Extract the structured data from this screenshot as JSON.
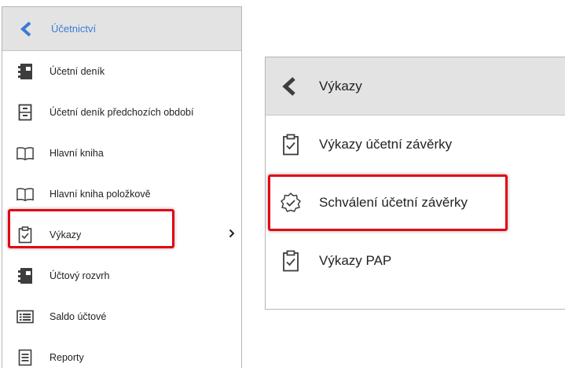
{
  "left_menu": {
    "title": "Účetnictví",
    "items": [
      {
        "label": "Účetní deník",
        "icon": "journal-icon"
      },
      {
        "label": "Účetní deník předchozích období",
        "icon": "cabinet-icon"
      },
      {
        "label": "Hlavní kniha",
        "icon": "book-icon"
      },
      {
        "label": "Hlavní kniha položkově",
        "icon": "book-icon"
      },
      {
        "label": "Výkazy",
        "icon": "clipboard-check-icon",
        "has_submenu": true
      },
      {
        "label": "Účtový rozvrh",
        "icon": "journal-icon"
      },
      {
        "label": "Saldo účtové",
        "icon": "list-icon"
      },
      {
        "label": "Reporty",
        "icon": "report-icon"
      }
    ]
  },
  "right_menu": {
    "title": "Výkazy",
    "items": [
      {
        "label": "Výkazy účetní závěrky",
        "icon": "clipboard-check-icon"
      },
      {
        "label": "Schválení účetní závěrky",
        "icon": "badge-check-icon"
      },
      {
        "label": "Výkazy PAP",
        "icon": "clipboard-check-icon"
      }
    ]
  },
  "colors": {
    "accent": "#3a7bd5",
    "highlight": "#e30613",
    "header_bg": "#e3e3e3"
  }
}
